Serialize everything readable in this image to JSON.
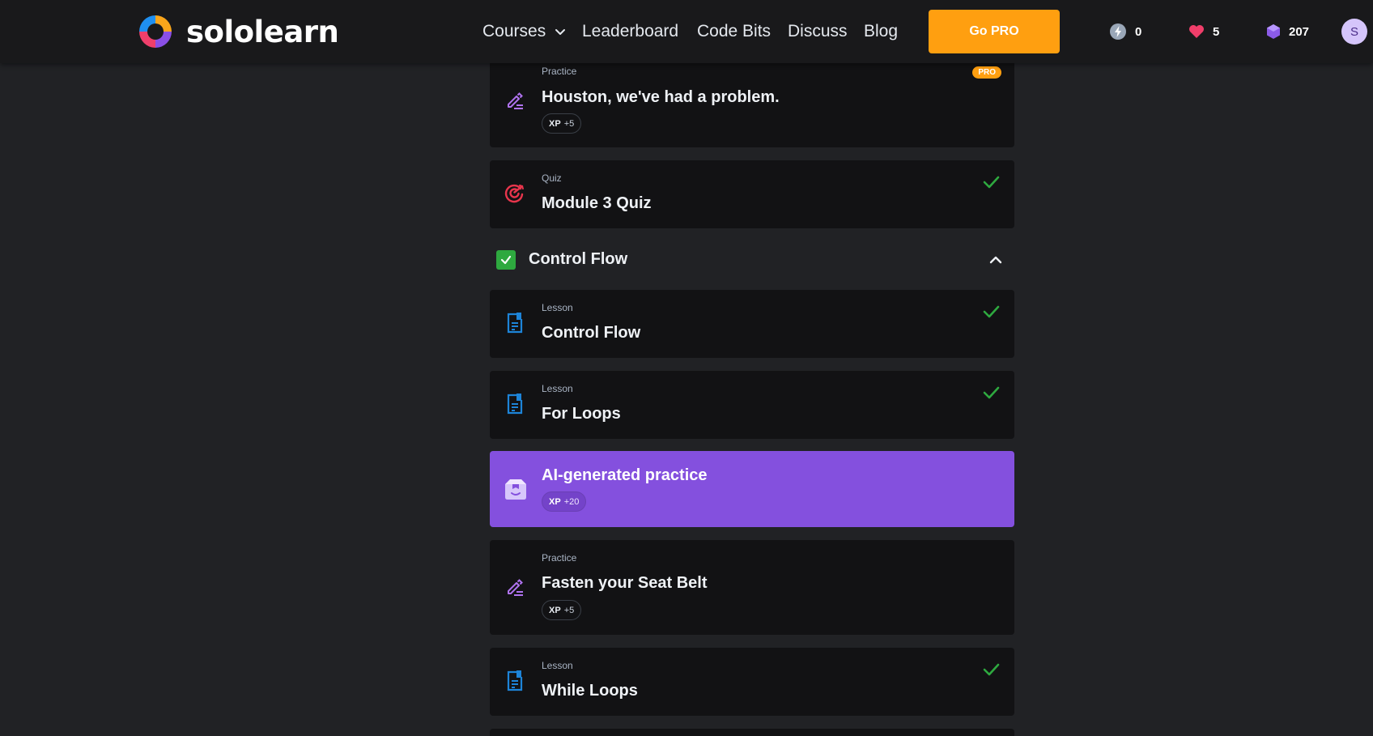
{
  "header": {
    "brand": "sololearn",
    "nav": {
      "courses": "Courses",
      "leaderboard": "Leaderboard",
      "code_bits": "Code Bits",
      "discuss": "Discuss",
      "blog": "Blog"
    },
    "go_pro": "Go PRO",
    "stats": {
      "streak": "0",
      "hearts": "5",
      "bits": "207"
    },
    "avatar_initial": "S"
  },
  "cards": [
    {
      "kind": "Practice",
      "title": "Houston, we've had a problem.",
      "xp_label": "XP",
      "xp_value": "+5",
      "badge": "PRO",
      "icon": "pencil-icon",
      "completed": false
    },
    {
      "kind": "Quiz",
      "title": "Module 3 Quiz",
      "icon": "target-icon",
      "completed": true
    },
    {
      "kind": "Lesson",
      "title": "Control Flow",
      "icon": "lesson-icon",
      "completed": true
    },
    {
      "kind": "Lesson",
      "title": "For Loops",
      "icon": "lesson-icon",
      "completed": true
    },
    {
      "title": "AI-generated practice",
      "xp_label": "XP",
      "xp_value": "+20",
      "icon": "ai-practice-icon",
      "active": true
    },
    {
      "kind": "Practice",
      "title": "Fasten your Seat Belt",
      "xp_label": "XP",
      "xp_value": "+5",
      "icon": "pencil-icon",
      "completed": false
    },
    {
      "kind": "Lesson",
      "title": "While Loops",
      "icon": "lesson-icon",
      "completed": true
    }
  ],
  "section": {
    "title": "Control Flow",
    "completed": true,
    "expanded": true
  },
  "colors": {
    "background": "#212225",
    "topbar": "#19191b",
    "card": "#121214",
    "active_card": "#8450de",
    "go_pro": "#ff9f10",
    "check_green": "#2ea93f",
    "quiz_red": "#e8354c",
    "lesson_blue": "#1d84d8",
    "practice_purple": "#b073f0"
  }
}
